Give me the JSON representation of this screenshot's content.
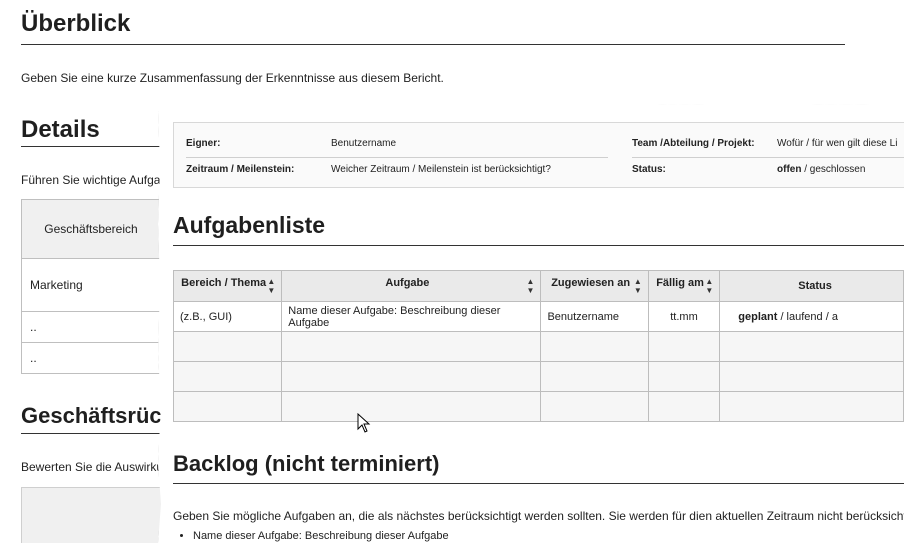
{
  "back": {
    "overview_title": "Überblick",
    "overview_text": "Geben Sie eine kurze Zusammenfassung der Erkenntnisse aus diesem Bericht.",
    "details_title": "Details",
    "details_text": "Führen Sie wichtige Aufgal",
    "table_header": "Geschäftsbereich",
    "table_rows": [
      "Marketing",
      "..",
      ".."
    ],
    "impact_title": "Geschäftsrüc",
    "impact_text": "Bewerten Sie die Auswirku"
  },
  "front": {
    "info": {
      "owner_label": "Eigner:",
      "owner_value": "Benutzername",
      "team_label": "Team /Abteilung / Projekt:",
      "team_value": "Wofür / für wen gilt diese Li",
      "period_label": "Zeitraum / Meilenstein:",
      "period_value": "Weicher Zeitraum / Meilenstein ist berücksichtigt?",
      "status_label": "Status:",
      "status_value_bold": "offen",
      "status_value_rest": " / geschlossen"
    },
    "tasks_title": "Aufgabenliste",
    "columns": [
      "Bereich / Thema",
      "Aufgabe",
      "Zugewiesen an",
      "Fällig am",
      "Status"
    ],
    "first_row": {
      "area": "(z.B., GUI)",
      "task": "Name dieser Aufgabe: Beschreibung dieser Aufgabe",
      "assignee": "Benutzername",
      "due": "tt.mm",
      "status_bold": "geplant",
      "status_rest": " / laufend / a"
    },
    "backlog_title": "Backlog (nicht terminiert)",
    "backlog_text": "Geben Sie mögliche Aufgaben an, die als nächstes berücksichtigt werden sollten. Sie werden für dien aktuellen Zeitraum nicht berücksichtigt:",
    "backlog_item": "Name dieser Aufgabe: Beschreibung dieser Aufgabe"
  }
}
